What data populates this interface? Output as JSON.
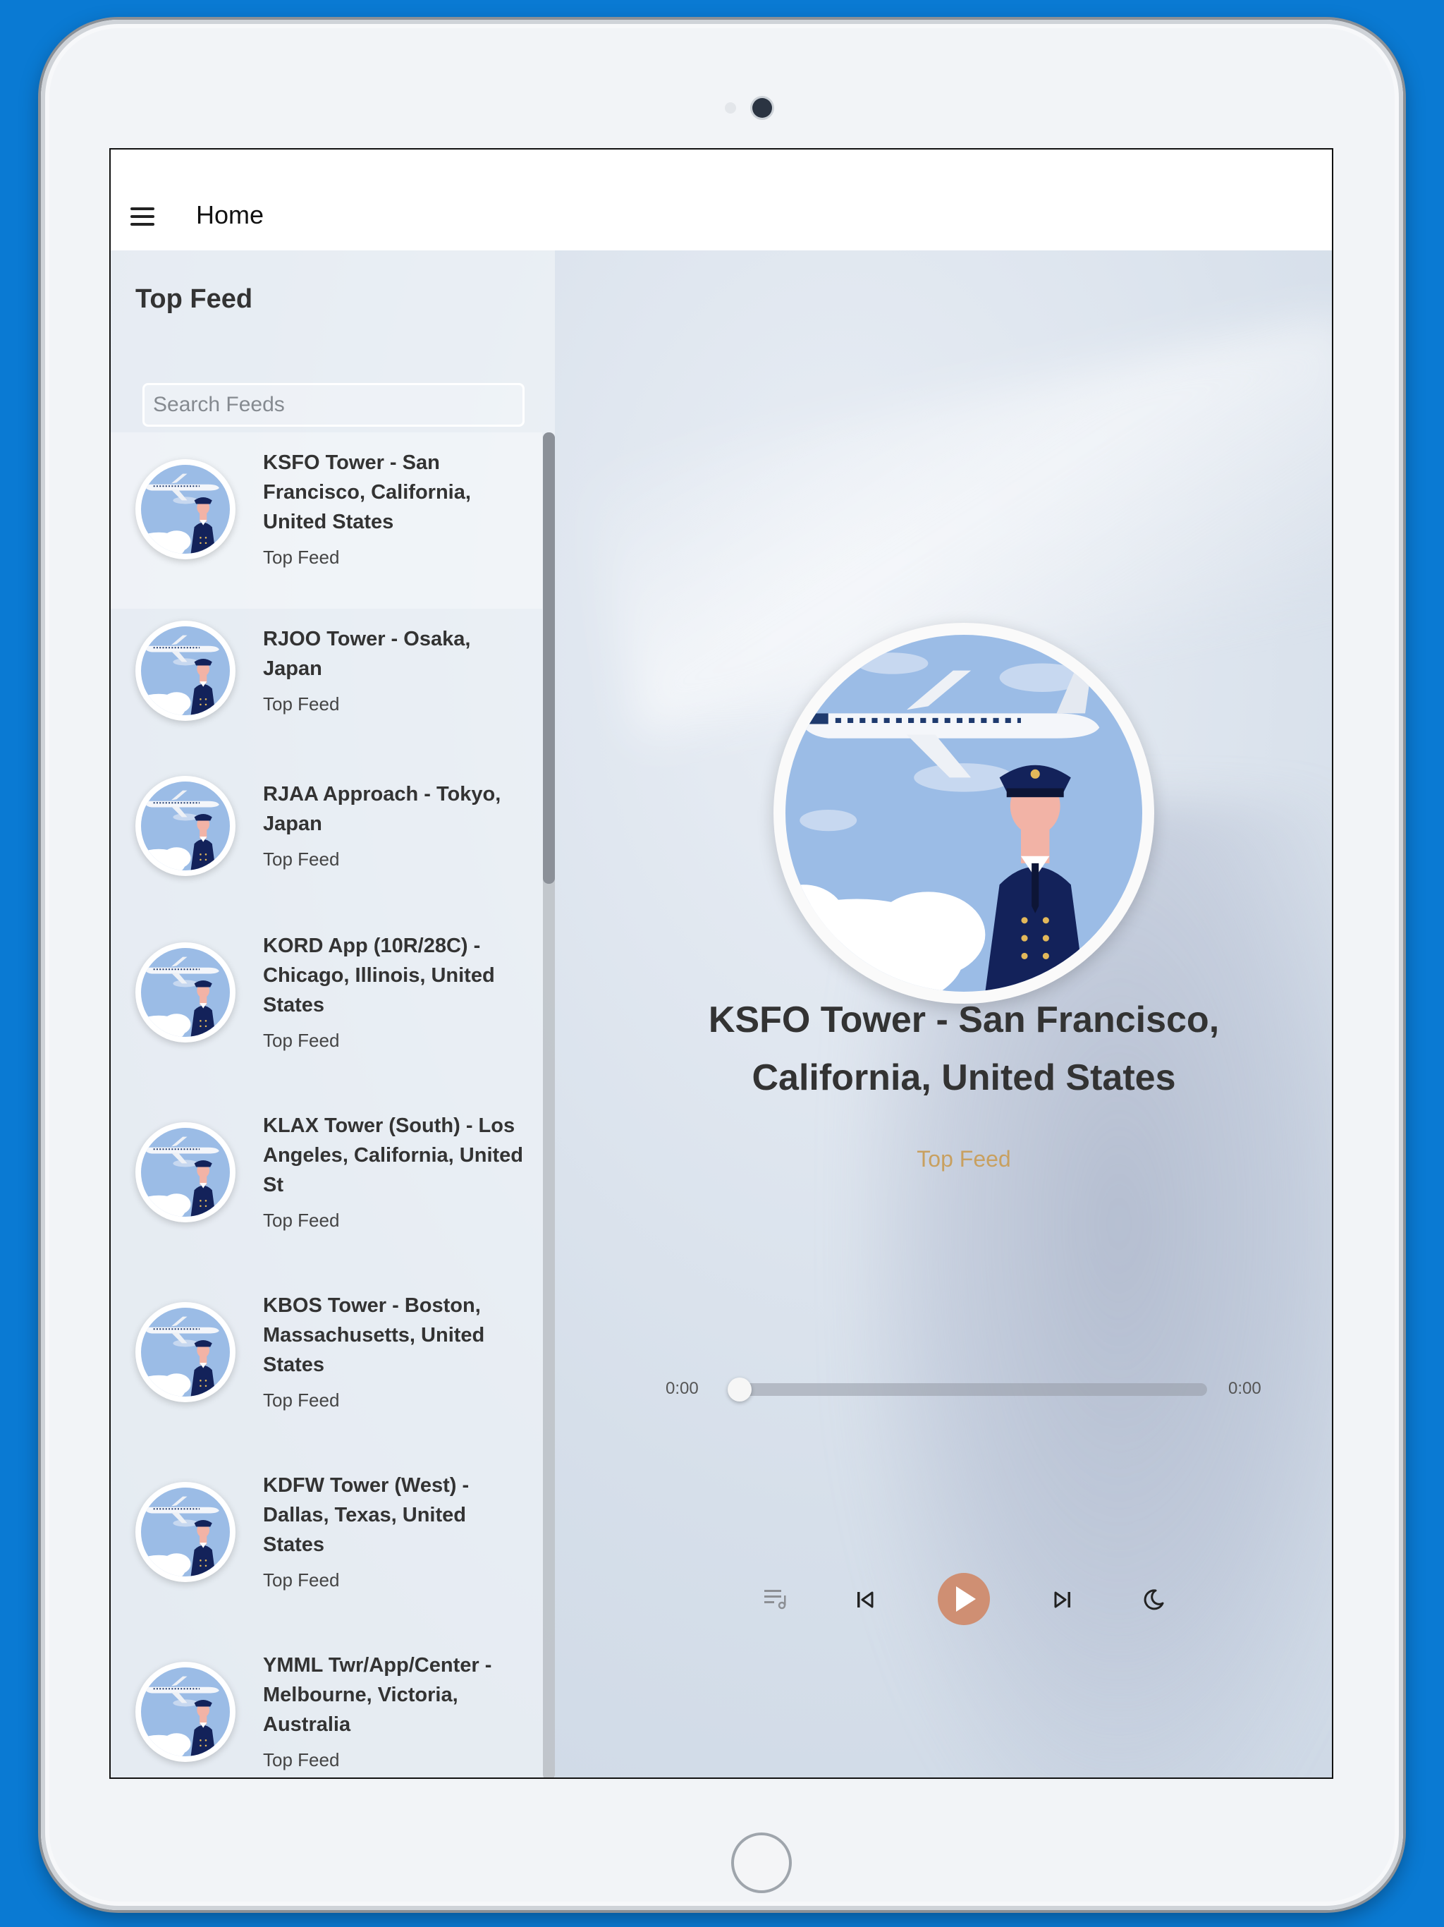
{
  "app": {
    "title": "Home"
  },
  "sidebar": {
    "title": "Top Feed",
    "search_placeholder": "Search Feeds",
    "items": [
      {
        "title": "KSFO Tower - San Francisco, California, United States",
        "subtitle": "Top Feed"
      },
      {
        "title": "RJOO Tower - Osaka, Japan",
        "subtitle": "Top Feed"
      },
      {
        "title": "RJAA Approach - Tokyo, Japan",
        "subtitle": "Top Feed"
      },
      {
        "title": "KORD App (10R/28C) - Chicago, Illinois, United States",
        "subtitle": "Top Feed"
      },
      {
        "title": "KLAX Tower (South) - Los Angeles, California, United St",
        "subtitle": "Top Feed"
      },
      {
        "title": "KBOS Tower - Boston, Massachusetts, United States",
        "subtitle": "Top Feed"
      },
      {
        "title": "KDFW Tower (West) - Dallas, Texas, United States",
        "subtitle": "Top Feed"
      },
      {
        "title": "YMML Twr/App/Center - Melbourne, Victoria, Australia",
        "subtitle": "Top Feed"
      }
    ]
  },
  "player": {
    "title": "KSFO Tower - San Francisco, California, United States",
    "subtitle": "Top Feed",
    "time_current": "0:00",
    "time_total": "0:00",
    "progress": 0,
    "accent_color": "#cf8f73",
    "subtitle_color": "#c8a060",
    "controls": [
      "playlist-icon",
      "skip-previous-icon",
      "play-icon",
      "skip-next-icon",
      "moon-icon"
    ]
  }
}
